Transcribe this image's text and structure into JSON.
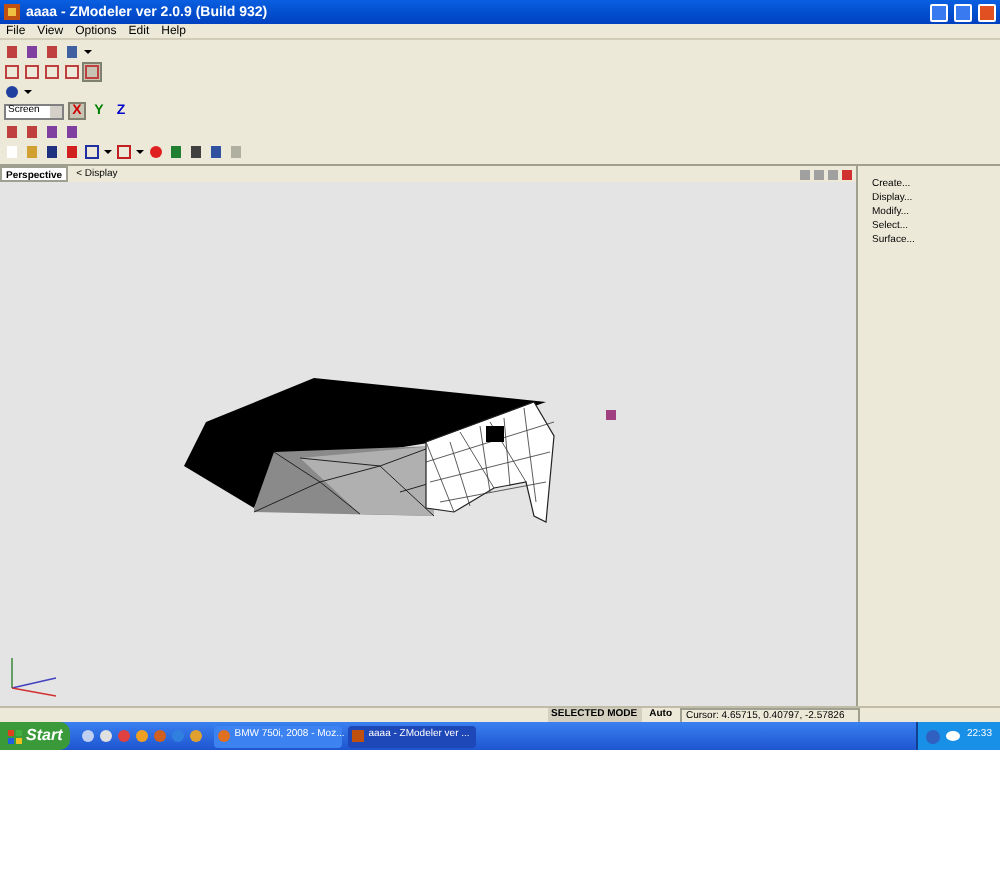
{
  "window": {
    "title": "aaaa - ZModeler ver 2.0.9 (Build 932)"
  },
  "menu": [
    {
      "label": "File"
    },
    {
      "label": "View"
    },
    {
      "label": "Options"
    },
    {
      "label": "Edit"
    },
    {
      "label": "Help"
    }
  ],
  "toolbar": {
    "space_dropdown": "Screen",
    "axes": [
      {
        "label": "X",
        "selected": true,
        "color": "#cc0000"
      },
      {
        "label": "Y",
        "selected": false,
        "color": "#008000"
      },
      {
        "label": "Z",
        "selected": false,
        "color": "#0000cc"
      }
    ]
  },
  "viewport_tabs": [
    {
      "label": "Perspective",
      "selected": true
    },
    {
      "label": "< Display",
      "selected": false
    }
  ],
  "side_panel": {
    "items": [
      {
        "label": "Create..."
      },
      {
        "label": "Display..."
      },
      {
        "label": "Modify..."
      },
      {
        "label": "Select..."
      },
      {
        "label": "Surface..."
      }
    ]
  },
  "status_bar": {
    "mode": "SELECTED MODE",
    "snap": "Auto",
    "cursor": "Cursor: 4.65715, 0.40797, -2.57826"
  },
  "taskbar": {
    "start": "Start",
    "tasks": [
      {
        "label": "BMW 750i, 2008 - Moz...",
        "selected": false
      },
      {
        "label": "aaaa - ZModeler ver ...",
        "selected": true
      }
    ],
    "clock": "22:33"
  }
}
